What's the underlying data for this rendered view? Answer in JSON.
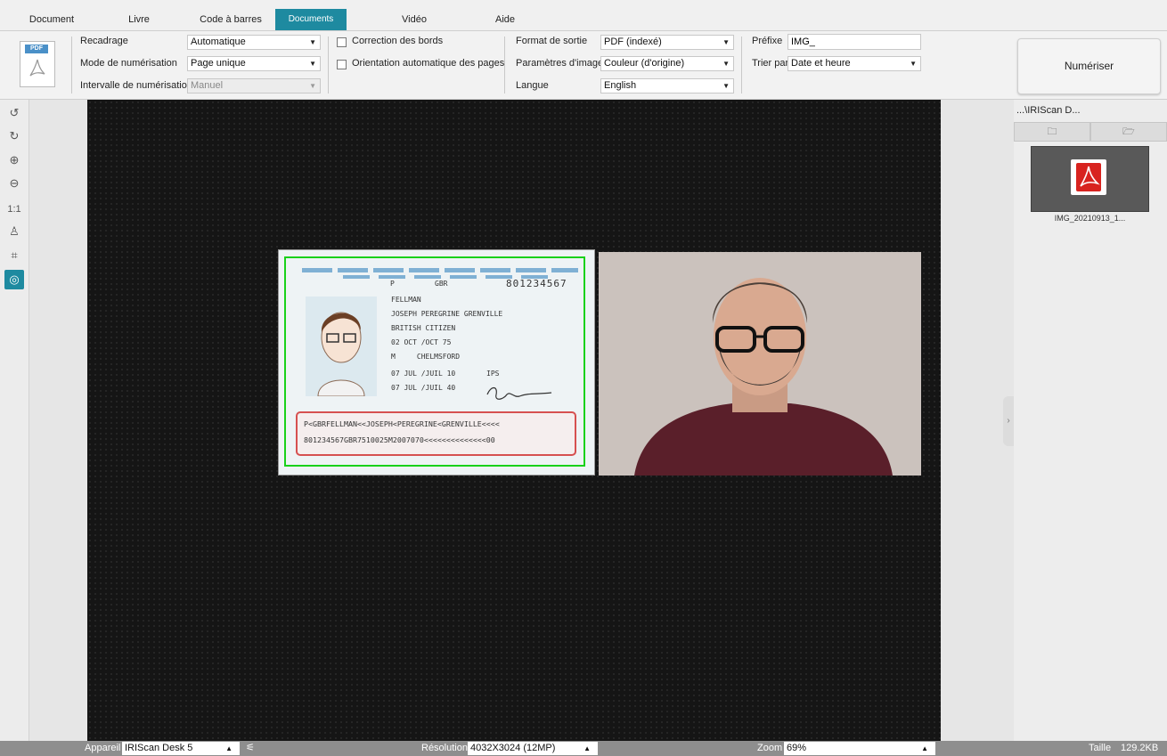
{
  "tabs": [
    {
      "label": "Document"
    },
    {
      "label": "Livre"
    },
    {
      "label": "Code à barres"
    },
    {
      "label": "Documents d'identité",
      "active": true
    },
    {
      "label": "Vidéo"
    },
    {
      "label": "Aide"
    }
  ],
  "ribbon": {
    "pdf_icon_text": "PDF",
    "crop_label": "Recadrage",
    "crop_value": "Automatique",
    "scan_mode_label": "Mode de numérisation",
    "scan_mode_value": "Page unique",
    "interval_label": "Intervalle de numérisation",
    "interval_value": "Manuel",
    "edge_correction_label": "Correction des bords",
    "auto_orientation_label": "Orientation automatique des pages",
    "output_format_label": "Format de sortie",
    "output_format_value": "PDF (indexé)",
    "image_params_label": "Paramètres d'image",
    "image_params_value": "Couleur (d'origine)",
    "language_label": "Langue",
    "language_value": "English",
    "prefix_label": "Préfixe",
    "prefix_value": "IMG_",
    "sort_label": "Trier par",
    "sort_value": "Date et heure",
    "scan_button": "Numériser"
  },
  "left_tools": [
    {
      "icon": "rotate-left-icon",
      "glyph": "↺"
    },
    {
      "icon": "rotate-right-icon",
      "glyph": "↻"
    },
    {
      "icon": "zoom-in-icon",
      "glyph": "⊕"
    },
    {
      "icon": "zoom-out-icon",
      "glyph": "⊖"
    },
    {
      "icon": "actual-size-icon",
      "glyph": "1:1"
    },
    {
      "icon": "stamp-icon",
      "glyph": "♙"
    },
    {
      "icon": "crop-frame-icon",
      "glyph": "⌗"
    },
    {
      "icon": "webcam-icon",
      "glyph": "◎",
      "active": true
    }
  ],
  "id_card": {
    "type": "P",
    "country": "GBR",
    "number": "801234567",
    "surname": "FELLMAN",
    "given_names": "JOSEPH PEREGRINE GRENVILLE",
    "nationality": "BRITISH CITIZEN",
    "dob": "02 OCT /OCT 75",
    "sex_place": "M     CHELMSFORD",
    "issue": "07 JUL /JUIL 10",
    "authority": "IPS",
    "expiry": "07 JUL /JUIL 40",
    "mrz1": "P<GBRFELLMAN<<JOSEPH<PEREGRINE<GRENVILLE<<<<",
    "mrz2": "801234567GBR7510025M2007070<<<<<<<<<<<<<<00"
  },
  "right_panel": {
    "path": "...\\IRIScan D...",
    "thumb_label": "IMG_20210913_1..."
  },
  "status": {
    "device_label": "Appareil",
    "device_value": "IRIScan Desk 5",
    "resolution_label": "Résolution",
    "resolution_value": "4032X3024 (12MP)",
    "zoom_label": "Zoom",
    "zoom_value": "69%",
    "size_label": "Taille",
    "size_value": "129.2KB"
  },
  "colors": {
    "accent": "#1e8aa0",
    "crop_frame": "#19d11a",
    "mrz_border": "#d65050"
  }
}
